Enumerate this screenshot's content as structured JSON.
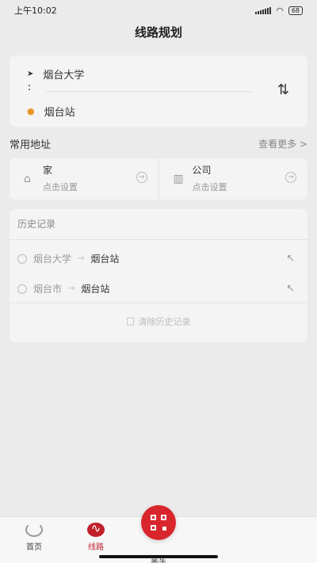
{
  "status_bar": {
    "time": "上午10:02",
    "battery": "68"
  },
  "header": {
    "title": "线路规划"
  },
  "route": {
    "origin": "烟台大学",
    "destination": "烟台站",
    "swap_symbol": "⇅"
  },
  "frequent": {
    "title": "常用地址",
    "more": "查看更多 >",
    "items": [
      {
        "name": "家",
        "hint": "点击设置",
        "icon": "home-icon"
      },
      {
        "name": "公司",
        "hint": "点击设置",
        "icon": "building-icon"
      }
    ]
  },
  "history": {
    "title": "历史记录",
    "items": [
      {
        "from": "烟台大学",
        "to": "烟台站"
      },
      {
        "from": "烟台市",
        "to": "烟台站"
      }
    ],
    "clear_label": "清除历史记录"
  },
  "tabs": [
    {
      "label": "首页",
      "icon": "home-logo-icon"
    },
    {
      "label": "线路",
      "icon": "route-icon",
      "active": true
    },
    {
      "label": "乘车",
      "icon": "qr-code-icon"
    }
  ],
  "colors": {
    "accent": "#d9262c"
  }
}
